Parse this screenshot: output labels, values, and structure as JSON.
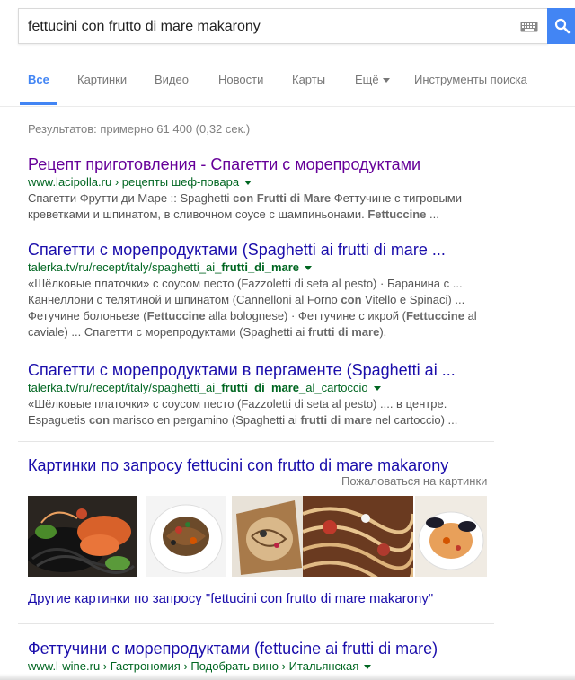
{
  "search": {
    "query": "fettucini con frutto di mare makarony",
    "keyboard_icon": "keyboard-icon",
    "search_icon": "search-icon",
    "button_color": "#4285f4"
  },
  "tabs": [
    {
      "label": "Все",
      "active": true
    },
    {
      "label": "Картинки"
    },
    {
      "label": "Видео"
    },
    {
      "label": "Новости"
    },
    {
      "label": "Карты"
    },
    {
      "label": "Ещё"
    },
    {
      "label": "Инструменты поиска"
    }
  ],
  "stats": "Результатов: примерно 61 400 (0,32 сек.)",
  "results": [
    {
      "title": "Рецепт приготовления - Спагетти с морепродуктами",
      "url": "www.lacipolla.ru › рецепты шеф-повара",
      "snippet": [
        "Спагетти Фрутти ди Маре :: Spaghetti <b>con Frutti di Mare</b> Феттучине с тигровыми",
        "креветками и шпинатом, в сливочном соусе с шампиньонами. <b>Fettuccine</b> ..."
      ]
    },
    {
      "title": "Спагетти с морепродуктами (Spaghetti ai frutti di mare ...",
      "url": "talerka.tv/ru/recept/italy/spaghetti_ai_<b>frutti_di_mare</b>",
      "snippet": [
        "«Шёлковые платочки» с соусом песто (Fazzoletti di seta al pesto) · Баранина с ...",
        "Каннеллони с телятиной и шпинатом (Cannelloni al Forno <b>con</b> Vitello e Spinaci) ...",
        "Фетучине болоньезе (<b>Fettuccine</b> alla bolognese) · Феттучине с икрой (<b>Fettuccine</b> al",
        "caviale) ... Спагетти с морепродуктами (Spaghetti ai <b>frutti di mare</b>)."
      ]
    },
    {
      "title": "Спагетти с морепродуктами в пергаменте (Spaghetti ai ...",
      "url": "talerka.tv/ru/recept/italy/spaghetti_ai_<b>frutti_di_mare</b>_al_cartoccio",
      "snippet": [
        "«Шёлковые платочки» с соусом песто (Fazzoletti di seta al pesto) .... в центре.",
        "Espaguetis <b>con</b> marisco en pergamino (Spaghetti ai <b>frutti di mare</b> nel cartoccio) ..."
      ]
    }
  ],
  "images": {
    "header": "Картинки по запросу fettucini con frutto di mare makarony",
    "report": "Пожаловаться на картинки",
    "thumbnails": [
      "pasta-shrimp-image",
      "pasta-plate-image",
      "pasta-paper-image",
      "pasta-closeup-image",
      "pasta-mussels-image"
    ],
    "more": "Другие картинки по запросу \"fettucini con frutto di mare makarony\""
  },
  "last_result": {
    "title": "Феттучини с морепродуктами (fettucine ai frutti di mare)",
    "url": "www.l-wine.ru › Гастрономия › Подобрать вино › Итальянская"
  },
  "colors": {
    "link": "#1a0dab",
    "visited": "#660099",
    "url": "#006621",
    "snippet": "#545454",
    "accent": "#4285f4"
  }
}
